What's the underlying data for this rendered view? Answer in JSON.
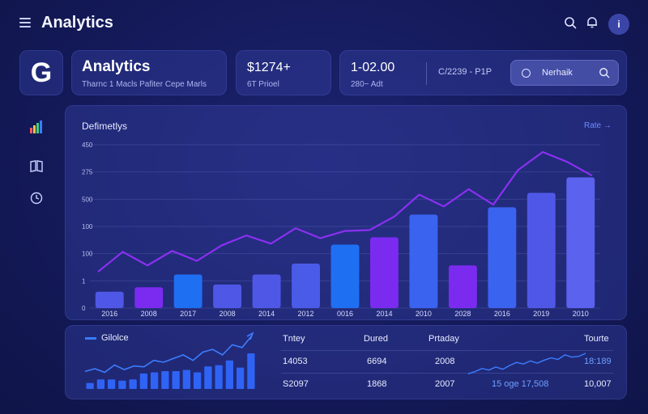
{
  "header": {
    "title": "Analytics",
    "avatar_label": "i"
  },
  "icons": {
    "search": "search-icon",
    "notifications": "bell-icon",
    "profile": "user-icon"
  },
  "logo": {
    "letter": "G"
  },
  "stats": {
    "analytics": {
      "title": "Analytics",
      "subtitle": "Tharnc 1 Macls Pafiter Cepe Marls"
    },
    "price": {
      "value": "$1274+",
      "label": "6T Prioel"
    },
    "wide": {
      "value": "1-02.00",
      "label": "280~ Adt",
      "middle": "C/2239 - P1P"
    }
  },
  "search": {
    "value": "Nerhaik"
  },
  "sidebar": {
    "items": [
      "chart-bars-icon",
      "book-icon",
      "clock-icon"
    ]
  },
  "chart": {
    "title": "Defimetlys",
    "link_label": "Rate →"
  },
  "chart_data": {
    "type": "bar",
    "y_tick_labels": [
      "450",
      "275",
      "500",
      "100",
      "100",
      "1",
      "0"
    ],
    "categories": [
      "2016",
      "2008",
      "2017",
      "2008",
      "2014",
      "2012",
      "0016",
      "2014",
      "2010",
      "2028",
      "2016",
      "2019",
      "2010"
    ],
    "values": [
      18,
      23,
      37,
      26,
      37,
      49,
      70,
      78,
      103,
      47,
      111,
      127,
      144
    ],
    "bar_colors": [
      "#4f58e6",
      "#7b2bf0",
      "#1f6ff2",
      "#4f58e6",
      "#4f58e6",
      "#4a5be8",
      "#1f6ff2",
      "#7b2bf0",
      "#3a63f0",
      "#7b2bf0",
      "#3a63f0",
      "#4f58e6",
      "#5b62ee"
    ],
    "line": [
      40,
      62,
      47,
      63,
      52,
      69,
      80,
      71,
      88,
      77,
      85,
      86,
      101,
      125,
      112,
      131,
      114,
      152,
      172,
      161,
      146
    ],
    "line_color": "#8a30f0",
    "ylim": [
      0,
      180
    ]
  },
  "bottom": {
    "legend": "Gilolce",
    "sparkline": [
      12,
      15,
      11,
      19,
      14,
      18,
      17,
      24,
      22,
      26,
      30,
      24,
      33,
      36,
      30,
      41,
      38,
      51
    ],
    "mini_bars": [
      5,
      8,
      8,
      7,
      8,
      13,
      14,
      15,
      15,
      16,
      14,
      19,
      20,
      24,
      18,
      30
    ],
    "table": {
      "headers": [
        "Tntey",
        "Dured",
        "Prtaday",
        "Tourte"
      ],
      "rows": [
        [
          "14053",
          "6694",
          "2008",
          "18:189"
        ],
        [
          "S2097",
          "1868",
          "2007",
          "10,007"
        ]
      ],
      "trend_label": "15 oge 17,508",
      "trend": [
        5,
        8,
        12,
        10,
        14,
        11,
        16,
        20,
        18,
        22,
        19,
        23,
        26,
        24,
        30,
        27,
        28,
        32
      ]
    }
  }
}
